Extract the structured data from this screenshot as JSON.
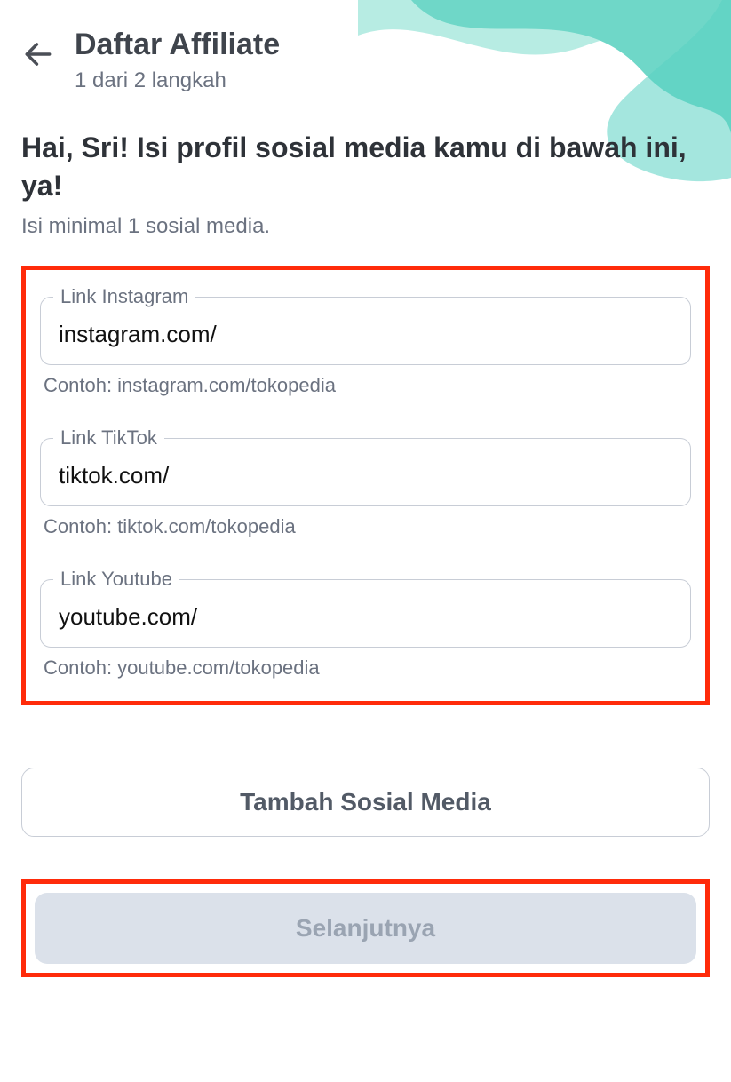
{
  "header": {
    "title": "Daftar Affiliate",
    "subtitle": "1 dari 2 langkah"
  },
  "greeting": {
    "main": "Hai, Sri! Isi profil sosial media kamu di bawah ini, ya!",
    "sub": "Isi minimal 1 sosial media."
  },
  "fields": {
    "instagram": {
      "label": "Link Instagram",
      "value": "instagram.com/",
      "hint": "Contoh: instagram.com/tokopedia"
    },
    "tiktok": {
      "label": "Link TikTok",
      "value": "tiktok.com/",
      "hint": "Contoh: tiktok.com/tokopedia"
    },
    "youtube": {
      "label": "Link Youtube",
      "value": "youtube.com/",
      "hint": "Contoh: youtube.com/tokopedia"
    }
  },
  "buttons": {
    "addSocial": "Tambah Sosial Media",
    "next": "Selanjutnya"
  },
  "colors": {
    "highlight": "#ff2b0a",
    "accent": "#6fd7c8",
    "accentLight": "#b7ece3"
  }
}
